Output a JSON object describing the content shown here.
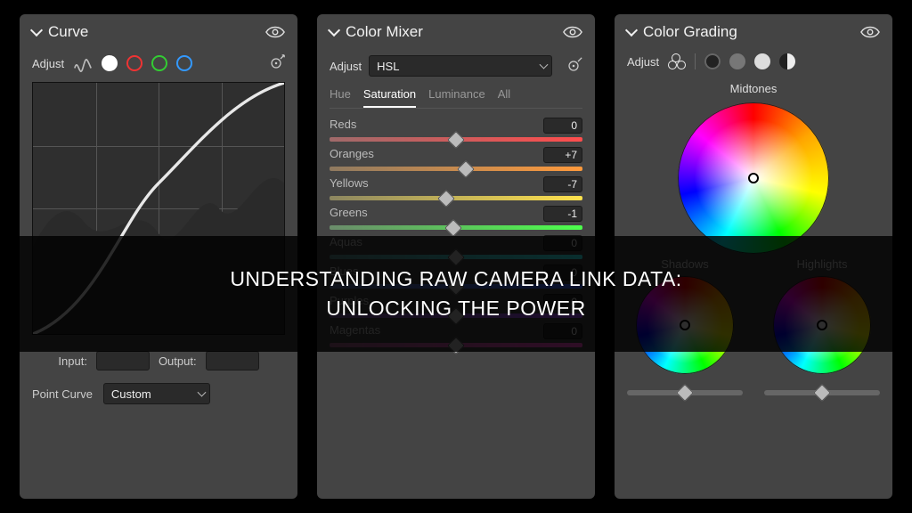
{
  "overlay": {
    "line1": "UNDERSTANDING RAW CAMERA LINK DATA:",
    "line2": "UNLOCKING THE POWER"
  },
  "curve": {
    "title": "Curve",
    "adjust_label": "Adjust",
    "input_label": "Input:",
    "output_label": "Output:",
    "input_value": "",
    "output_value": "",
    "point_curve_label": "Point Curve",
    "point_curve_value": "Custom"
  },
  "mixer": {
    "title": "Color Mixer",
    "adjust_label": "Adjust",
    "adjust_value": "HSL",
    "tabs": {
      "hue": "Hue",
      "sat": "Saturation",
      "lum": "Luminance",
      "all": "All"
    },
    "active_tab": "Saturation",
    "sliders": [
      {
        "name": "Reds",
        "value": "0",
        "pct": 50,
        "grad": "linear-gradient(90deg,#a06a6a,#ff4d4d)"
      },
      {
        "name": "Oranges",
        "value": "+7",
        "pct": 54,
        "grad": "linear-gradient(90deg,#8f7a60,#ff9a3c)"
      },
      {
        "name": "Yellows",
        "value": "-7",
        "pct": 46,
        "grad": "linear-gradient(90deg,#8c8660,#ffe24d)"
      },
      {
        "name": "Greens",
        "value": "-1",
        "pct": 49,
        "grad": "linear-gradient(90deg,#6b8c6b,#4cff4c)"
      },
      {
        "name": "Aquas",
        "value": "0",
        "pct": 50,
        "grad": "linear-gradient(90deg,#5f8c8c,#33ffff)"
      },
      {
        "name": "Blues",
        "value": "0",
        "pct": 50,
        "grad": "linear-gradient(90deg,#5f6f9c,#3a66ff)"
      },
      {
        "name": "Purples",
        "value": "0",
        "pct": 50,
        "grad": "linear-gradient(90deg,#7a5f9c,#a64dff)"
      },
      {
        "name": "Magentas",
        "value": "0",
        "pct": 50,
        "grad": "linear-gradient(90deg,#9c5f84,#ff4dcf)"
      }
    ]
  },
  "grading": {
    "title": "Color Grading",
    "adjust_label": "Adjust",
    "midtones_label": "Midtones",
    "shadows_label": "Shadows",
    "highlights_label": "Highlights"
  }
}
